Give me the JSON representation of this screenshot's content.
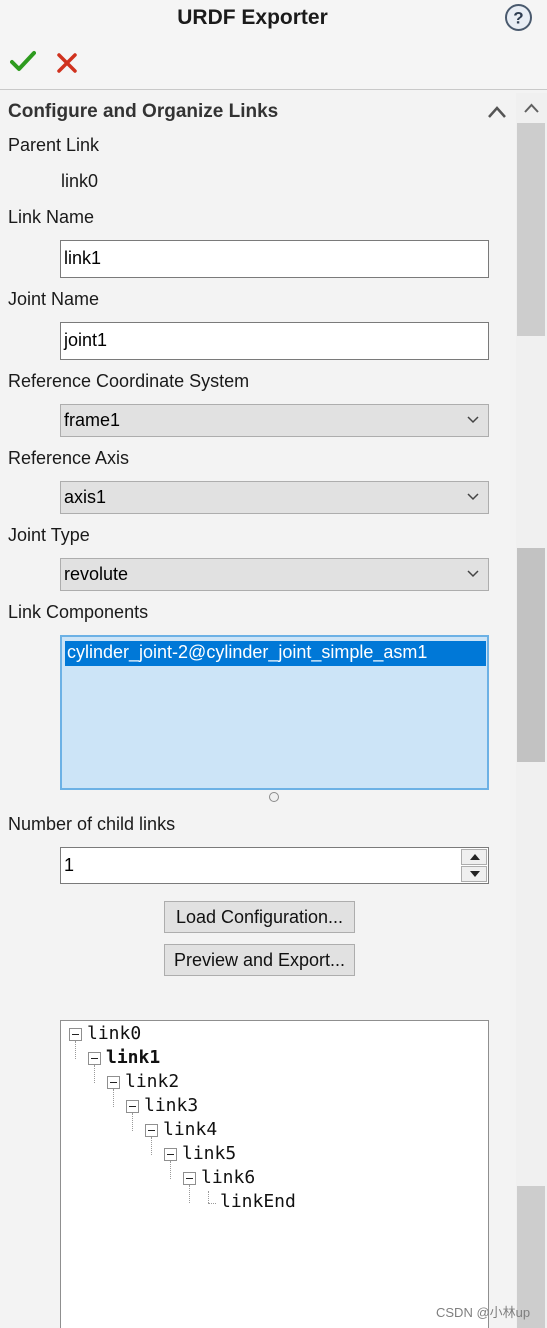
{
  "window": {
    "title": "URDF Exporter",
    "help_icon": "help-question-icon",
    "ok_icon": "green-checkmark-icon",
    "cancel_icon": "red-x-icon"
  },
  "section": {
    "title": "Configure and Organize Links",
    "collapse_icon": "chevron-up-icon"
  },
  "form": {
    "parent_link_label": "Parent Link",
    "parent_link_value": "link0",
    "link_name_label": "Link Name",
    "link_name_value": "link1",
    "joint_name_label": "Joint Name",
    "joint_name_value": "joint1",
    "ref_coord_label": "Reference Coordinate System",
    "ref_coord_value": "frame1",
    "ref_axis_label": "Reference Axis",
    "ref_axis_value": "axis1",
    "joint_type_label": "Joint Type",
    "joint_type_value": "revolute",
    "link_components_label": "Link Components",
    "link_components": [
      "cylinder_joint-2@cylinder_joint_simple_asm1"
    ],
    "child_links_label": "Number of child links",
    "child_links_value": "1"
  },
  "buttons": {
    "load_config": "Load Configuration...",
    "preview_export": "Preview and Export..."
  },
  "tree": {
    "nodes": [
      {
        "label": "link0",
        "selected": false
      },
      {
        "label": "link1",
        "selected": true
      },
      {
        "label": "link2",
        "selected": false
      },
      {
        "label": "link3",
        "selected": false
      },
      {
        "label": "link4",
        "selected": false
      },
      {
        "label": "link5",
        "selected": false
      },
      {
        "label": "link6",
        "selected": false
      },
      {
        "label": "linkEnd",
        "selected": false
      }
    ]
  },
  "watermark": "CSDN @小林up",
  "colors": {
    "accent_selection": "#0078d7",
    "list_background": "#cce4f7",
    "ok_green": "#2e9b1f",
    "cancel_red": "#d0321e"
  }
}
